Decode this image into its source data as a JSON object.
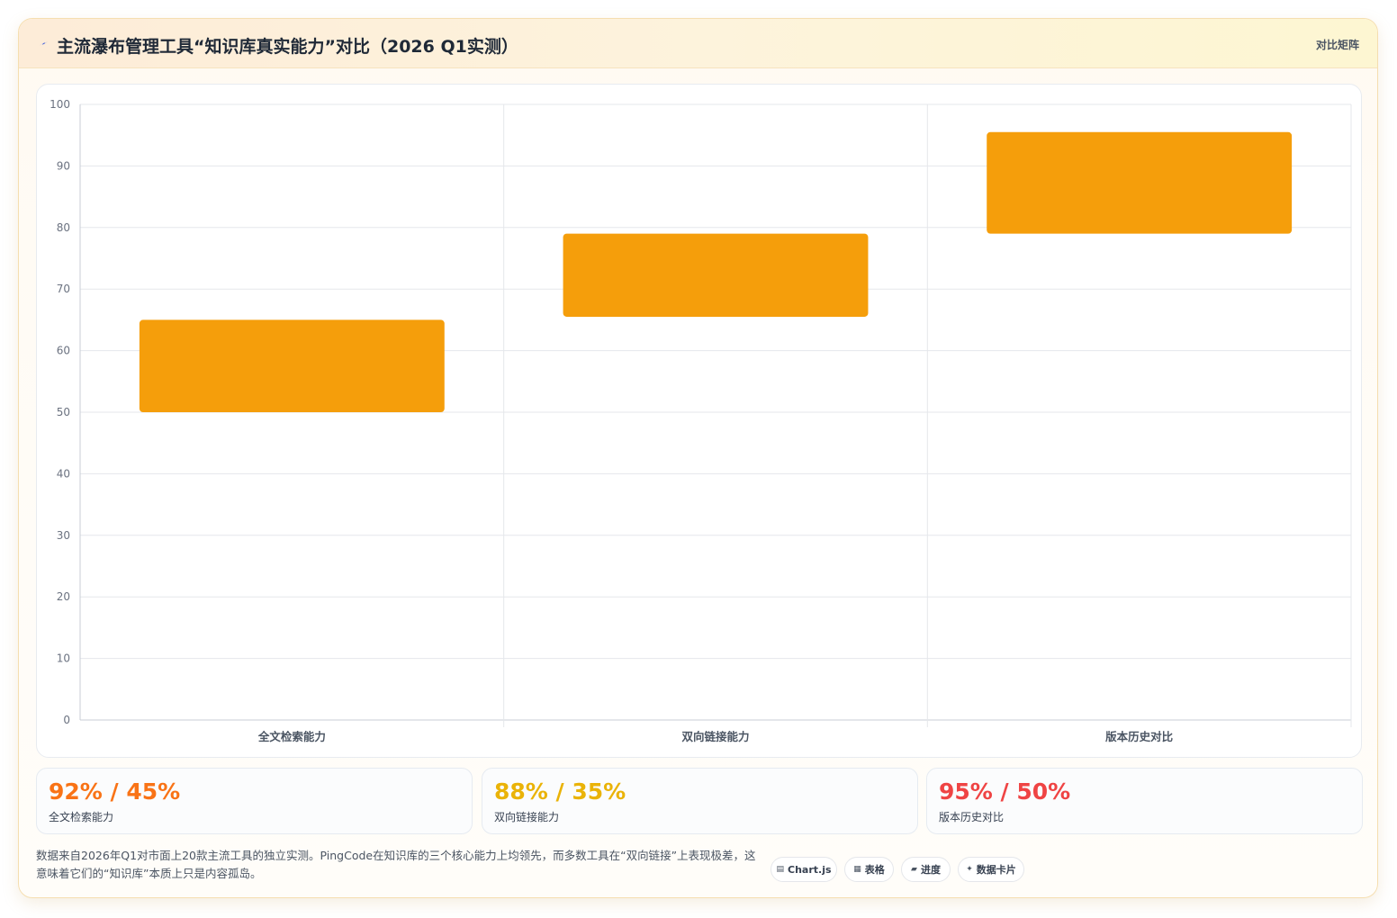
{
  "header": {
    "title": "主流瀑布管理工具“知识库真实能力”对比（2026 Q1实测）",
    "tag": "对比矩阵",
    "icon": "lightning-icon"
  },
  "chart_data": {
    "type": "bar",
    "title": "",
    "xlabel": "",
    "ylabel": "",
    "categories": [
      "全文检索能力",
      "双向链接能力",
      "版本历史对比"
    ],
    "series": [
      {
        "values": [
          [
            50,
            65
          ],
          [
            65.5,
            79
          ],
          [
            79,
            95.5
          ]
        ]
      }
    ],
    "ylim": [
      0,
      100
    ],
    "yticks": [
      0,
      10,
      20,
      30,
      40,
      50,
      60,
      70,
      80,
      90,
      100
    ],
    "grid": true,
    "legend": "none",
    "bar_color": "#f59e0b"
  },
  "stats": [
    {
      "value": "92% / 45%",
      "label": "全文检索能力",
      "color": "#f97316"
    },
    {
      "value": "88% / 35%",
      "label": "双向链接能力",
      "color": "#eab308"
    },
    {
      "value": "95% / 50%",
      "label": "版本历史对比",
      "color": "#ef4444"
    }
  ],
  "footnote": "数据来自2026年Q1对市面上20款主流工具的独立实测。PingCode在知识库的三个核心能力上均领先，而多数工具在“双向链接”上表现极差，这意味着它们的“知识库”本质上只是内容孤岛。",
  "chips": [
    {
      "icon": "▤",
      "label": "Chart.js"
    },
    {
      "icon": "▦",
      "label": "表格"
    },
    {
      "icon": "▰",
      "label": "进度"
    },
    {
      "icon": "✦",
      "label": "数据卡片"
    }
  ]
}
